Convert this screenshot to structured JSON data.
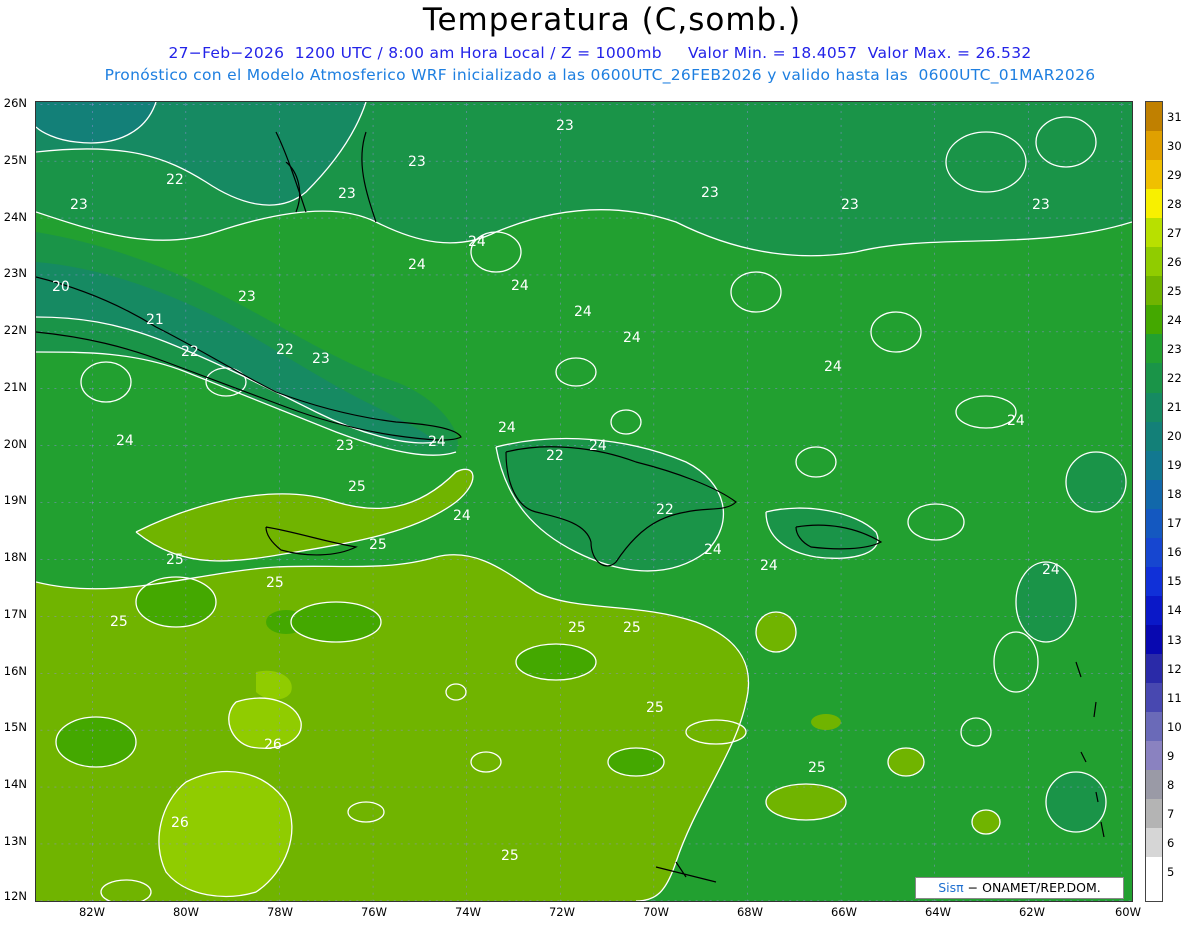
{
  "header": {
    "title": "Temperatura (C,somb.)",
    "line1": "27−Feb−2026  1200 UTC / 8:00 am Hora Local / Z = 1000mb     Valor Min. = 18.4057  Valor Max. = 26.532",
    "line2": "Pronóstico con el Modelo Atmosferico WRF inicializado a las 0600UTC_26FEB2026 y valido hasta las  0600UTC_01MAR2026"
  },
  "axes": {
    "lat_labels": [
      "26N",
      "25N",
      "24N",
      "23N",
      "22N",
      "21N",
      "20N",
      "19N",
      "18N",
      "17N",
      "16N",
      "15N",
      "14N",
      "13N",
      "12N"
    ],
    "lon_labels": [
      "82W",
      "80W",
      "78W",
      "76W",
      "74W",
      "72W",
      "70W",
      "68W",
      "66W",
      "64W",
      "62W",
      "60W"
    ]
  },
  "colorbar": {
    "labels": [
      "31",
      "30",
      "29",
      "28",
      "27",
      "26",
      "25",
      "24",
      "23",
      "22",
      "21",
      "20",
      "19",
      "18",
      "17",
      "16",
      "15",
      "14",
      "13",
      "12",
      "11",
      "10",
      "9",
      "8",
      "7",
      "6",
      "5"
    ],
    "colors": {
      "c31": "#c08000",
      "c30": "#e0a000",
      "c29": "#f0c000",
      "c28": "#f8f000",
      "c27": "#b8e000",
      "c26": "#90cc00",
      "c25": "#70b400",
      "c24": "#44a800",
      "c23": "#22a030",
      "c22": "#1a9448",
      "c21": "#168a62",
      "c20": "#138078",
      "c19": "#127890",
      "c18": "#1268aa",
      "c17": "#1458c0",
      "c16": "#1646d0",
      "c15": "#1030d8",
      "c14": "#0a18c8",
      "c13": "#0808b0",
      "c12": "#2a2aa8",
      "c11": "#4848b0",
      "c10": "#6a6ab8",
      "c9": "#8a82c0",
      "c8": "#9a9aa6",
      "c7": "#b4b4b4",
      "c6": "#d6d6d6",
      "c5": "#ffffff"
    }
  },
  "contour_labels": [
    "20",
    "21",
    "22",
    "22",
    "22",
    "22",
    "22",
    "23",
    "23",
    "23",
    "23",
    "23",
    "23",
    "23",
    "23",
    "23",
    "23",
    "24",
    "24",
    "24",
    "24",
    "24",
    "24",
    "24",
    "24",
    "24",
    "24",
    "24",
    "24",
    "24",
    "24",
    "24",
    "25",
    "25",
    "25",
    "25",
    "25",
    "25",
    "25",
    "25",
    "25",
    "25",
    "26",
    "26"
  ],
  "credit": {
    "brand": "Sisπ",
    "text": "− ONAMET/REP.DOM."
  }
}
